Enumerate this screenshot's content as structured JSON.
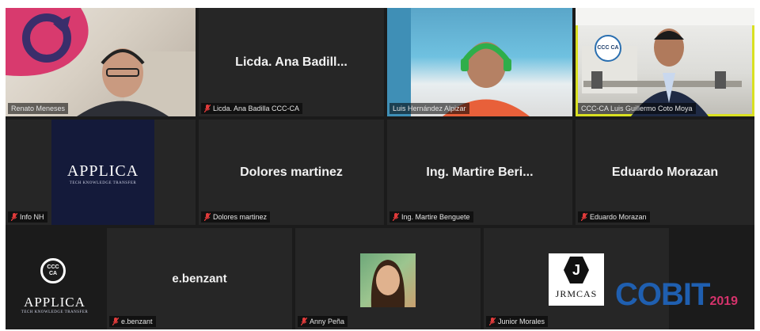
{
  "participants": {
    "renato": {
      "label": "Renato Meneses"
    },
    "ana": {
      "center": "Licda. Ana Badill...",
      "label": "Licda. Ana Badilla CCC-CA"
    },
    "luis": {
      "label": "Luis Hernández Alpizar"
    },
    "guillermo": {
      "label": "CCC-CA Luis Guillermo Coto Moya"
    },
    "infonh": {
      "label": "Info NH",
      "logo_text": "APPLICA",
      "logo_sub": "TECH KNOWLEDGE TRANSFER"
    },
    "dolores": {
      "center": "Dolores martinez",
      "label": "Dolores martinez"
    },
    "martire": {
      "center": "Ing. Martire Beri...",
      "label": "Ing. Martire Benguete"
    },
    "eduardo": {
      "center": "Eduardo Morazan",
      "label": "Eduardo Morazan"
    },
    "applica_logo": {
      "logo_text": "APPLICA",
      "logo_sub": "TECH KNOWLEDGE TRANSFER",
      "ccc_text": "CCC CA"
    },
    "ebenzant": {
      "center": "e.benzant",
      "label": "e.benzant"
    },
    "anny": {
      "label": "Anny Peña"
    },
    "junior": {
      "label": "Junior Morales",
      "logo_letter": "J",
      "logo_text": "JRMCAS"
    }
  },
  "branding": {
    "cobit_text": "COBIT",
    "cobit_year": "2019",
    "ccc_badge": "CCC CA"
  },
  "colors": {
    "active_outline": "#d9e021",
    "muted_mic": "#e23b3b",
    "tile_bg": "#262626"
  }
}
